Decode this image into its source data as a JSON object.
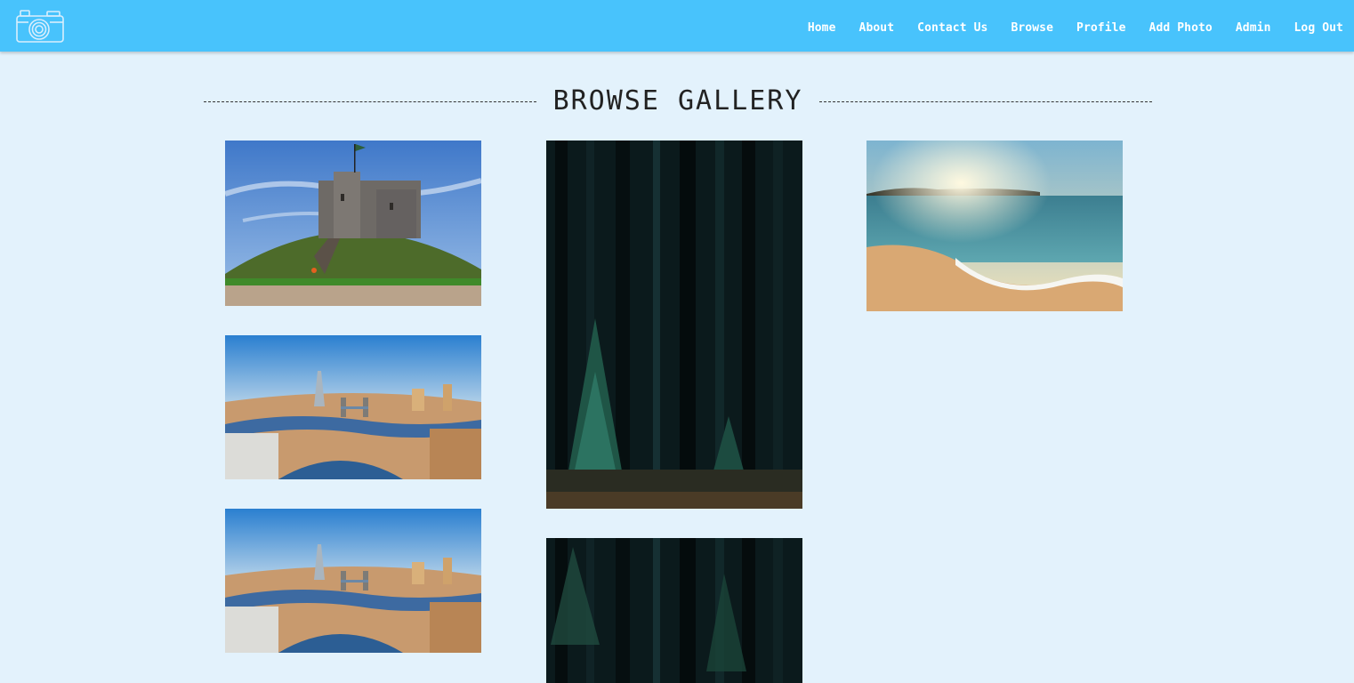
{
  "nav": {
    "logo_icon": "camera-icon",
    "items": [
      {
        "label": "Home"
      },
      {
        "label": "About"
      },
      {
        "label": "Contact Us"
      },
      {
        "label": "Browse"
      },
      {
        "label": "Profile"
      },
      {
        "label": "Add Photo"
      },
      {
        "label": "Admin"
      },
      {
        "label": "Log Out"
      }
    ]
  },
  "page": {
    "heading": "BROWSE GALLERY"
  },
  "gallery": {
    "photos": [
      {
        "subject": "castle on grassy hill"
      },
      {
        "subject": "london skyline with tower bridge"
      },
      {
        "subject": "london skyline with tower bridge"
      },
      {
        "subject": "dark pine forest"
      },
      {
        "subject": "dark pine forest"
      },
      {
        "subject": "beach at sunset"
      }
    ]
  },
  "colors": {
    "navbar": "#48c3fc",
    "background": "#e3f2fc",
    "nav_text": "#ffffff",
    "heading_text": "#222222"
  }
}
